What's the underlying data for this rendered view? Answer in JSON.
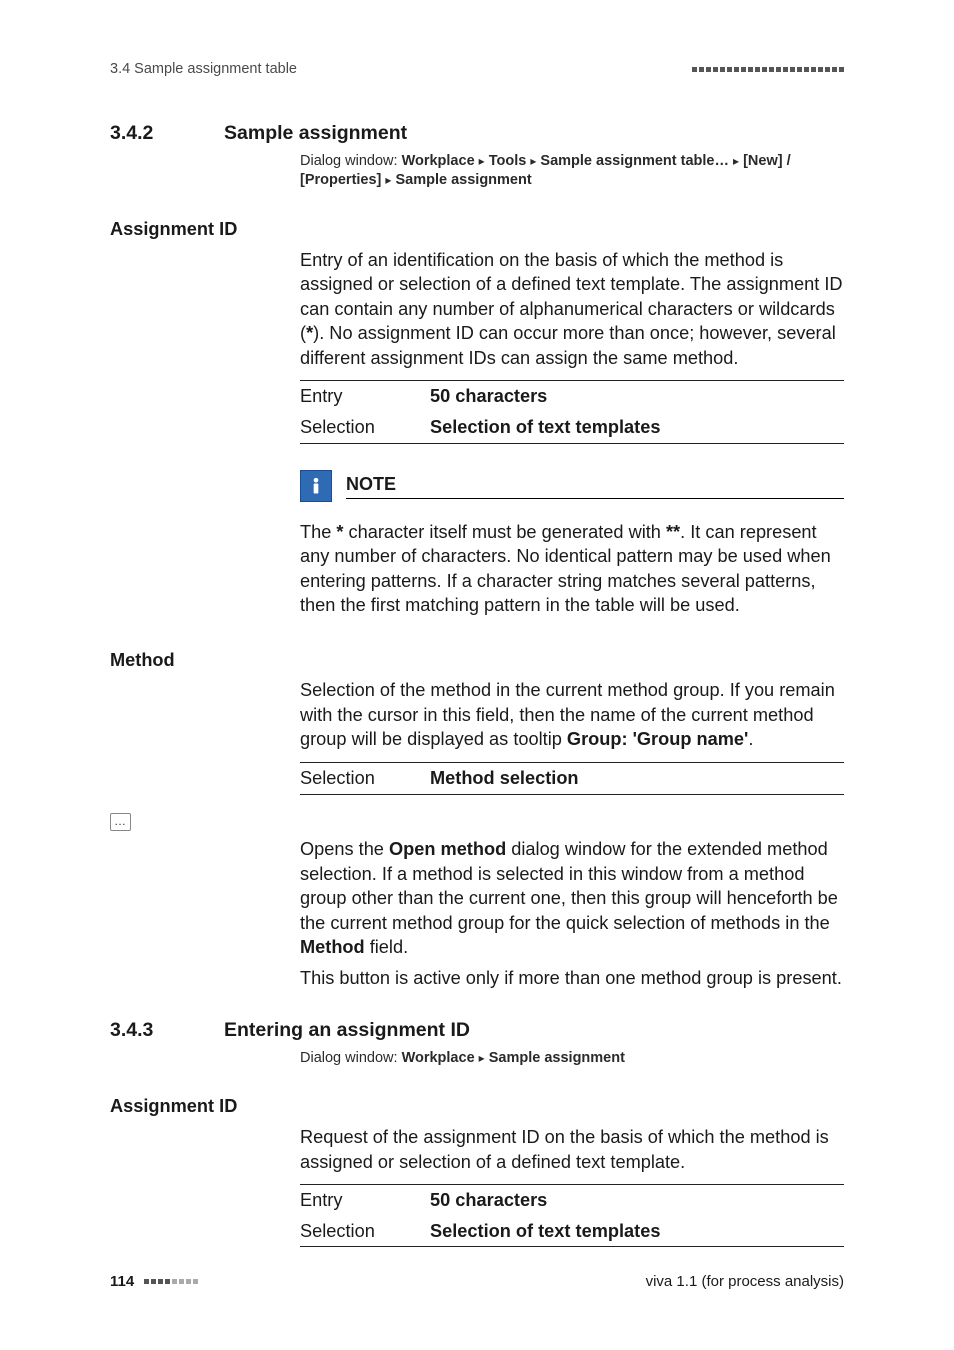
{
  "header": {
    "left": "3.4 Sample assignment table"
  },
  "s342": {
    "num": "3.4.2",
    "title": "Sample assignment",
    "dialog_prefix": "Dialog window: ",
    "dialog_parts": {
      "p1": "Workplace",
      "p2": "Tools",
      "p3": "Sample assignment table…",
      "p4": "[New] / [Properties]",
      "p5": "Sample assignment"
    }
  },
  "assignment_id_1": {
    "label": "Assignment ID",
    "para_a": "Entry of an identification on the basis of which the method is assigned or selection of a defined text template. The assignment ID can contain any number of alphanumerical characters or wildcards (",
    "wildcard": "*",
    "para_b": "). No assignment ID can occur more than once; however, several different assignment IDs can assign the same method.",
    "row1_k": "Entry",
    "row1_v": "50 characters",
    "row2_k": "Selection",
    "row2_v": "Selection of text templates"
  },
  "note": {
    "title": "NOTE",
    "body_a": "The ",
    "star1": "*",
    "body_b": " character itself must be generated with ",
    "star2": "**",
    "body_c": ". It can represent any number of characters. No identical pattern may be used when entering patterns. If a character string matches several patterns, then the first matching pattern in the table will be used."
  },
  "method": {
    "label": "Method",
    "para_a": "Selection of the method in the current method group. If you remain with the cursor in this field, then the name of the current method group will be displayed as tooltip ",
    "bold": "Group: 'Group name'",
    "para_b": ".",
    "row1_k": "Selection",
    "row1_v": "Method selection"
  },
  "ellipsis": {
    "para_a": "Opens the ",
    "bold1": "Open method",
    "para_b": " dialog window for the extended method selection. If a method is selected in this window from a method group other than the current one, then this group will henceforth be the current method group for the quick selection of methods in the ",
    "bold2": "Method",
    "para_c": " field.",
    "para2": "This button is active only if more than one method group is present."
  },
  "s343": {
    "num": "3.4.3",
    "title": "Entering an assignment ID",
    "dialog_prefix": "Dialog window: ",
    "dialog_parts": {
      "p1": "Workplace",
      "p2": "Sample assignment"
    }
  },
  "assignment_id_2": {
    "label": "Assignment ID",
    "para": "Request of the assignment ID on the basis of which the method is assigned or selection of a defined text template.",
    "row1_k": "Entry",
    "row1_v": "50 characters",
    "row2_k": "Selection",
    "row2_v": "Selection of text templates"
  },
  "footer": {
    "page": "114",
    "right": "viva 1.1 (for process analysis)"
  }
}
